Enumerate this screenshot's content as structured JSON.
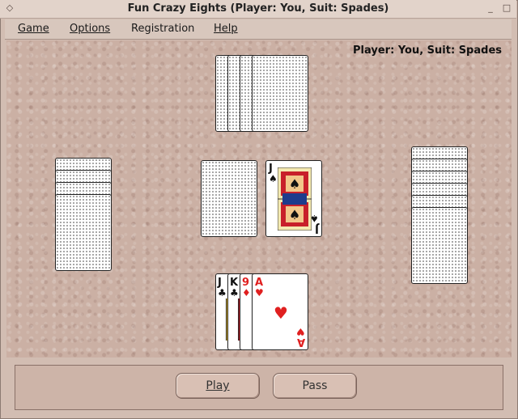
{
  "window": {
    "title": "Fun Crazy Eights (Player: You, Suit: Spades)"
  },
  "menu": [
    "Game",
    "Options",
    "Registration",
    "Help"
  ],
  "status": "Player: You, Suit: Spades",
  "table": {
    "top_opponent_cards": 4,
    "left_opponent_cards": 4,
    "right_opponent_cards": 6,
    "discard_top": {
      "rank": "J",
      "suit": "♠",
      "color": "black"
    },
    "player_hand": [
      {
        "rank": "J",
        "suit": "♣",
        "color": "black"
      },
      {
        "rank": "K",
        "suit": "♣",
        "color": "black"
      },
      {
        "rank": "9",
        "suit": "♦",
        "color": "red"
      },
      {
        "rank": "A",
        "suit": "♥",
        "color": "red"
      }
    ]
  },
  "buttons": {
    "play": "Play",
    "pass": "Pass"
  }
}
